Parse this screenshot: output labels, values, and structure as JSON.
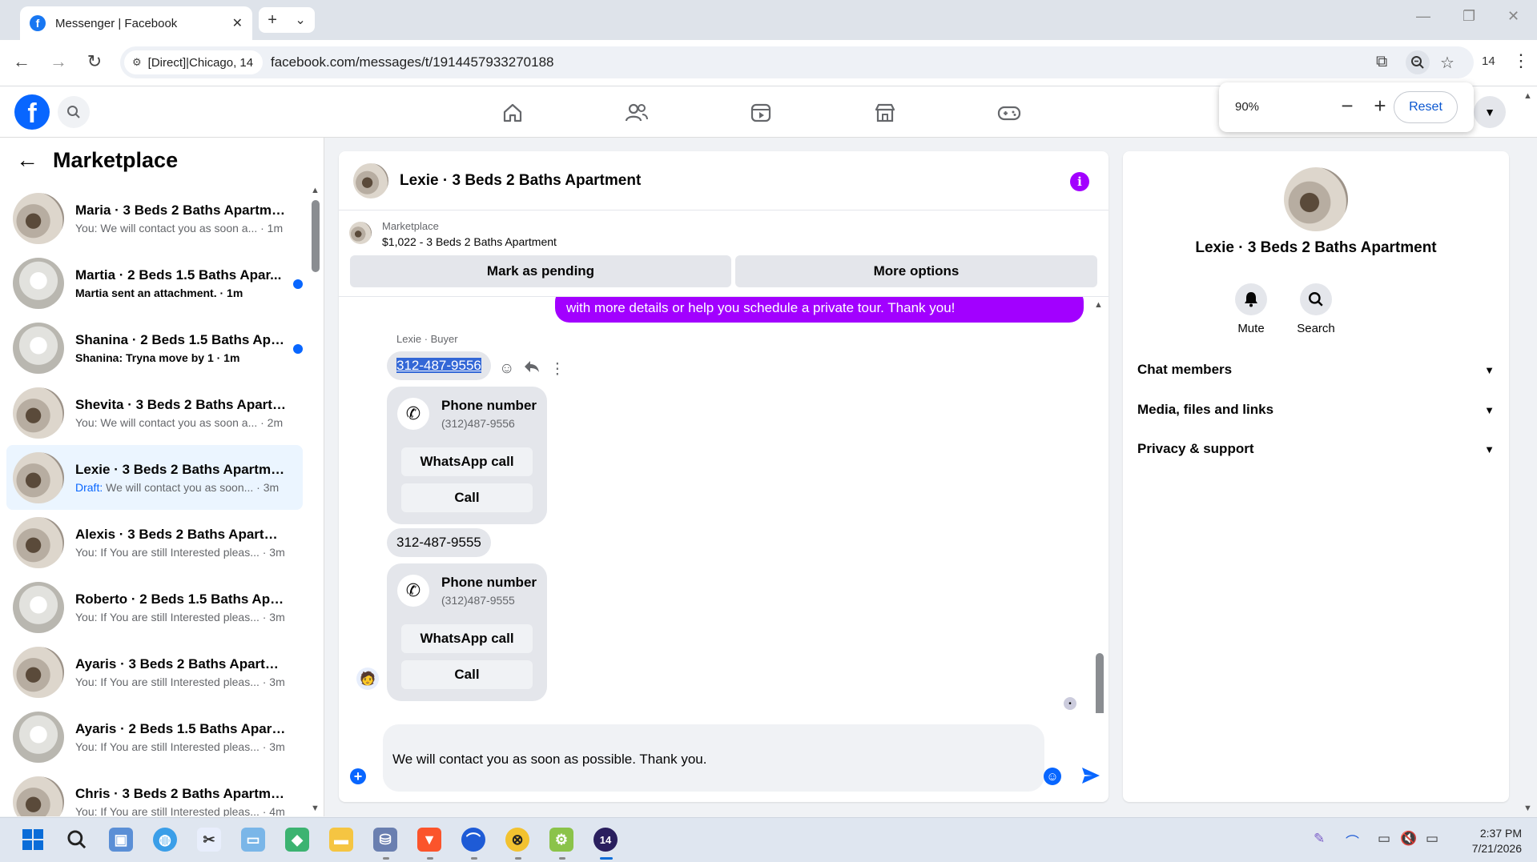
{
  "browser": {
    "tab_title": "Messenger | Facebook",
    "tab_close": "✕",
    "new_tab": "+",
    "tab_dropdown": "⌄",
    "site_chip": "[Direct]|Chicago, 14",
    "url": "facebook.com/messages/t/1914457933270188",
    "profile_count": "14"
  },
  "zoom_popup": {
    "level": "90%",
    "minus": "−",
    "plus": "+",
    "reset": "Reset"
  },
  "sidebar": {
    "title": "Marketplace",
    "conversations": [
      {
        "name": "Maria · 3 Beds 2 Baths Apartment",
        "snippet": "You: We will contact you as soon a... · 1m",
        "unread": false,
        "avatar": "dark"
      },
      {
        "name": "Martia · 2 Beds 1.5 Baths Apar...",
        "snippet": "Martia sent an attachment. · 1m",
        "unread": true,
        "avatar": "light"
      },
      {
        "name": "Shanina · 2 Beds 1.5 Baths Apa...",
        "snippet": "Shanina: Tryna move by 1 · 1m",
        "unread": true,
        "avatar": "light"
      },
      {
        "name": "Shevita · 3 Beds 2 Baths Apartm...",
        "snippet": "You: We will contact you as soon a... · 2m",
        "unread": false,
        "avatar": "dark"
      },
      {
        "name": "Lexie · 3 Beds 2 Baths Apartment",
        "draft_label": "Draft:",
        "snippet": " We will contact you as soon... · 3m",
        "unread": false,
        "active": true,
        "avatar": "dark"
      },
      {
        "name": "Alexis · 3 Beds 2 Baths Apartment",
        "snippet": "You: If You are still Interested pleas... · 3m",
        "unread": false,
        "avatar": "dark"
      },
      {
        "name": "Roberto · 2 Beds 1.5 Baths Apart...",
        "snippet": "You: If You are still Interested pleas... · 3m",
        "unread": false,
        "avatar": "light"
      },
      {
        "name": "Ayaris · 3 Beds 2 Baths Apartment",
        "snippet": "You: If You are still Interested pleas... · 3m",
        "unread": false,
        "avatar": "dark"
      },
      {
        "name": "Ayaris · 2 Beds 1.5 Baths Apartm...",
        "snippet": "You: If You are still Interested pleas... · 3m",
        "unread": false,
        "avatar": "light"
      },
      {
        "name": "Chris · 3 Beds 2 Baths Apartment",
        "snippet": "You: If You are still Interested pleas... · 4m",
        "unread": false,
        "avatar": "dark"
      }
    ]
  },
  "chat": {
    "title": "Lexie · 3 Beds 2 Baths Apartment",
    "marketplace_label": "Marketplace",
    "listing": "$1,022 - 3 Beds 2 Baths Apartment",
    "mark_pending": "Mark as pending",
    "more_options": "More options",
    "sent_message_tail": "with more details or help you schedule a private tour. Thank you!",
    "sender_label": "Lexie · Buyer",
    "messages": [
      {
        "phone": "312-487-9556",
        "card_title": "Phone number",
        "card_number": "(312)487-9556",
        "whatsapp": "WhatsApp call",
        "call": "Call"
      },
      {
        "phone": "312-487-9555",
        "card_title": "Phone number",
        "card_number": "(312)487-9555",
        "whatsapp": "WhatsApp call",
        "call": "Call"
      }
    ],
    "composer_text": "We will contact you as soon as possible. Thank you."
  },
  "right_panel": {
    "name": "Lexie · 3 Beds 2 Baths Apartment",
    "mute": "Mute",
    "search": "Search",
    "sections": [
      "Chat members",
      "Media, files and links",
      "Privacy & support"
    ]
  },
  "taskbar": {
    "time": "2:37 PM",
    "date": "7/21/2026",
    "badge": "14"
  },
  "colors": {
    "fb_blue": "#0866ff",
    "messenger_purple": "#a200ff"
  }
}
